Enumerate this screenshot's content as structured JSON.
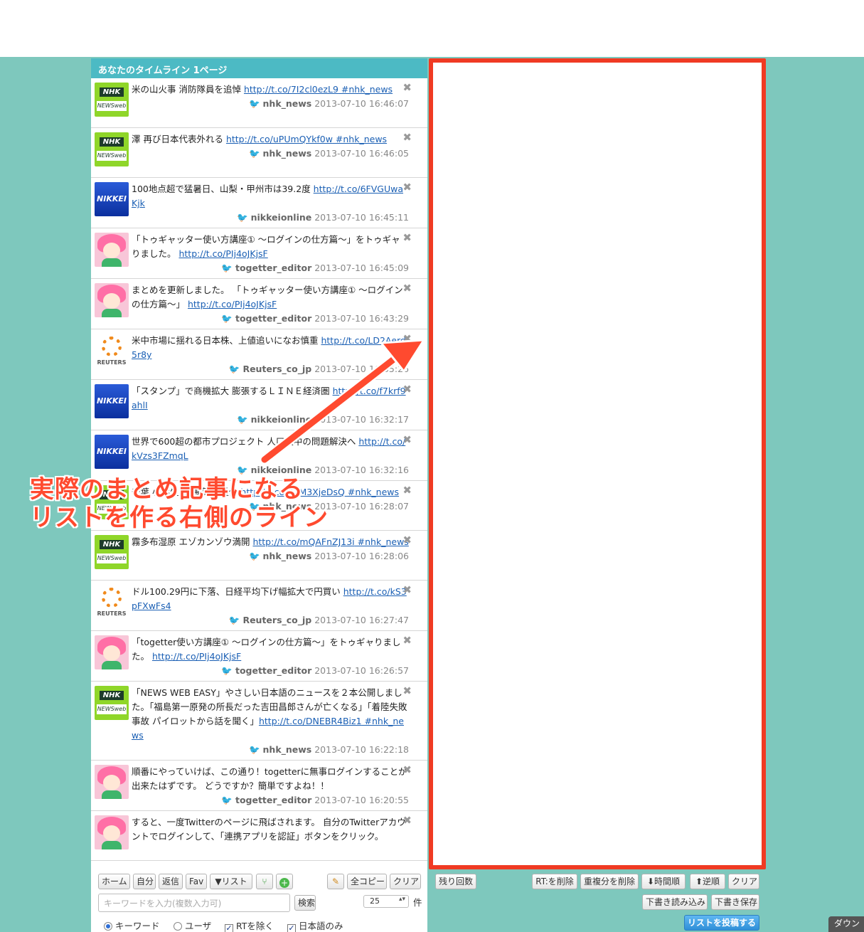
{
  "header": {
    "title": "あなたのタイムライン 1ページ"
  },
  "tweets": [
    {
      "avatar": "nhk",
      "text": "米の山火事 消防隊員を追悼 ",
      "link": "http://t.co/7I2cl0ezL9",
      "tag": " #nhk_news",
      "user": "nhk_news",
      "time": "2013-07-10 16:46:07"
    },
    {
      "avatar": "nhk",
      "text": "澤 再び日本代表外れる ",
      "link": "http://t.co/uPUmQYkf0w",
      "tag": " #nhk_news",
      "user": "nhk_news",
      "time": "2013-07-10 16:46:05"
    },
    {
      "avatar": "nikkei",
      "text": "100地点超で猛暑日、山梨・甲州市は39.2度 ",
      "link": "http://t.co/6FVGUwaKjk",
      "tag": "",
      "user": "nikkeionline",
      "time": "2013-07-10 16:45:11"
    },
    {
      "avatar": "togetter",
      "text": "「トゥギャッター使い方講座① 〜ログインの仕方篇〜」をトゥギャりました。 ",
      "link": "http://t.co/PIj4oJKjsF",
      "tag": "",
      "user": "togetter_editor",
      "time": "2013-07-10 16:45:09"
    },
    {
      "avatar": "togetter",
      "text": "まとめを更新しました。 「トゥギャッター使い方講座① 〜ログインの仕方篇〜」 ",
      "link": "http://t.co/PIj4oJKjsF",
      "tag": "",
      "user": "togetter_editor",
      "time": "2013-07-10 16:43:29"
    },
    {
      "avatar": "reuters",
      "text": "米中市場に揺れる日本株、上値追いになお慎重 ",
      "link": "http://t.co/LD2Aerd5r8y",
      "tag": "",
      "user": "Reuters_co_jp",
      "time": "2013-07-10 16:35:26"
    },
    {
      "avatar": "nikkei",
      "text": "「スタンプ」で商機拡大 膨張するＬＩＮＥ経済圏 ",
      "link": "http://t.co/f7krf9ahlI",
      "tag": "",
      "user": "nikkeionline",
      "time": "2013-07-10 16:32:17"
    },
    {
      "avatar": "nikkei",
      "text": "世界で600超の都市プロジェクト 人口集中の問題解決へ ",
      "link": "http://t.co/kVzs3FZmqL",
      "tag": "",
      "user": "nikkeionline",
      "time": "2013-07-10 16:32:16"
    },
    {
      "avatar": "nhk",
      "text": "千葉 小学生 交通事故 重体 ",
      "link": "http://t.co/K7M3XjeDsQ",
      "tag": " #nhk_news",
      "user": "nhk_news",
      "time": "2013-07-10 16:28:07"
    },
    {
      "avatar": "nhk",
      "text": "霧多布湿原 エゾカンゾウ満開 ",
      "link": "http://t.co/mQAFnZJ13i",
      "tag": " #nhk_news",
      "user": "nhk_news",
      "time": "2013-07-10 16:28:06"
    },
    {
      "avatar": "reuters",
      "text": "ドル100.29円に下落、日経平均下げ幅拡大で円買い ",
      "link": "http://t.co/kS3pFXwFs4",
      "tag": "",
      "user": "Reuters_co_jp",
      "time": "2013-07-10 16:27:47"
    },
    {
      "avatar": "togetter",
      "text": "「togetter使い方講座① 〜ログインの仕方篇〜」をトゥギャりました。 ",
      "link": "http://t.co/PIj4oJKjsF",
      "tag": "",
      "user": "togetter_editor",
      "time": "2013-07-10 16:26:57"
    },
    {
      "avatar": "nhk",
      "text": "「NEWS WEB EASY」やさしい日本語のニュースを２本公開しました。「福島第一原発の所長だった吉田昌郎さんが亡くなる」「着陸失敗事故 パイロットから話を聞く」",
      "link": "http://t.co/DNEBR4Biz1",
      "tag": " #nhk_news",
      "user": "nhk_news",
      "time": "2013-07-10 16:22:18"
    },
    {
      "avatar": "togetter",
      "text": "順番にやっていけば、この通り！togetterに無事ログインすることが出来たはずです。 どうですか？簡単ですよね！！",
      "link": "",
      "tag": "",
      "user": "togetter_editor",
      "time": "2013-07-10 16:20:55"
    },
    {
      "avatar": "togetter",
      "text": "すると、一度Twitterのページに飛ばされます。 自分のTwitterアカウントでログインして、「連携アプリを認証」ボタンをクリック。",
      "link": "",
      "tag": "",
      "user": "togetter_editor",
      "time": ""
    }
  ],
  "avatar_labels": {
    "nhk_top": "NHK",
    "nhk_bottom": "NEWSweb",
    "nikkei": "NIKKEI",
    "reuters": "REUTERS"
  },
  "toolbar_left": {
    "home": "ホーム",
    "self": "自分",
    "reply": "返信",
    "fav": "Fav",
    "list": "▼リスト",
    "edit_icon": "pencil-icon",
    "copy_all": "全コピー",
    "clear": "クリア"
  },
  "search": {
    "placeholder": "キーワードを入力(複数入力可)",
    "button": "検索",
    "count_value": "25",
    "count_unit": "件"
  },
  "filters": {
    "keyword": "キーワード",
    "user": "ユーザ",
    "exclude_rt": "RTを除く",
    "japanese_only": "日本語のみ"
  },
  "toolbar_right": {
    "remaining": "残り回数",
    "remove_rt": "RT:を削除",
    "remove_dup": "重複分を削除",
    "time_order": "時間順",
    "reverse_order": "逆順",
    "clear": "クリア",
    "load_draft": "下書き読み込み",
    "save_draft": "下書き保存",
    "post_list": "リストを投稿する"
  },
  "annotation": {
    "line1": "実際のまとめ記事になる",
    "line2": "リストを作る右側のライン"
  },
  "download_tab": "ダウン",
  "colors": {
    "background": "#7ec8bd",
    "header": "#4cbac4",
    "highlight": "#f03a23",
    "link": "#1a5fb4"
  }
}
